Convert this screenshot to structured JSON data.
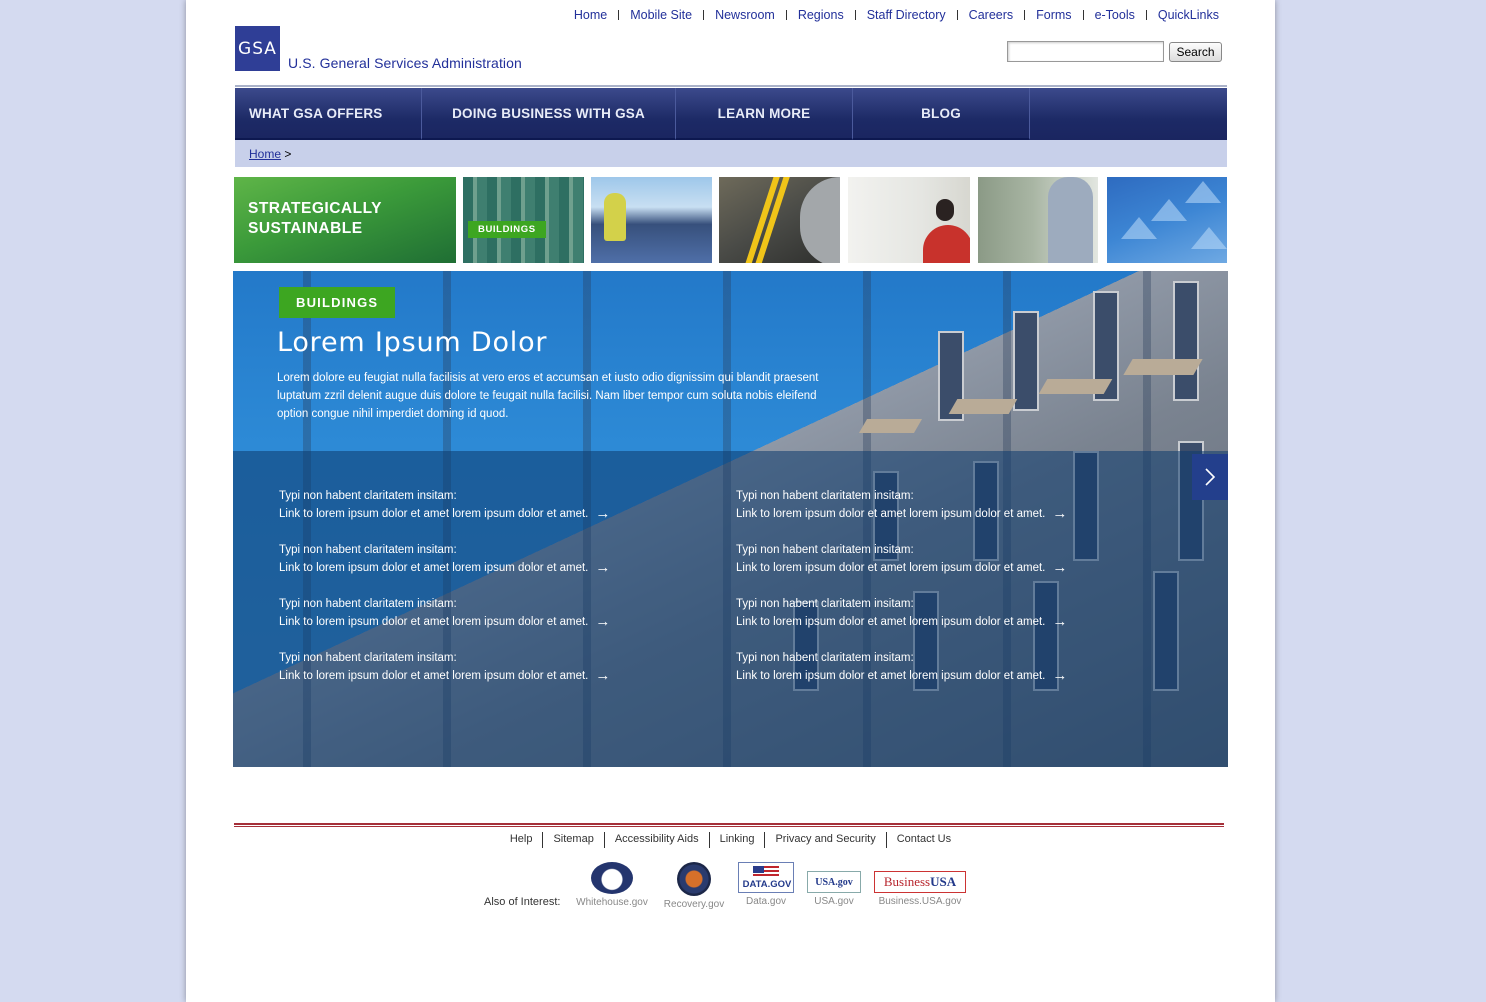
{
  "toplinks": [
    "Home",
    "Mobile Site",
    "Newsroom",
    "Regions",
    "Staff Directory",
    "Careers",
    "Forms",
    "e-Tools",
    "QuickLinks"
  ],
  "logo": {
    "mark": "GSA",
    "name": "U.S. General Services Administration"
  },
  "search": {
    "button": "Search",
    "value": ""
  },
  "nav": [
    "WHAT GSA OFFERS",
    "DOING BUSINESS WITH GSA",
    "LEARN MORE",
    "BLOG"
  ],
  "breadcrumb": {
    "home": "Home",
    "sep": ">"
  },
  "thumbs": {
    "featured": "STRATEGICALLY SUSTAINABLE",
    "badge": "BUILDINGS"
  },
  "hero": {
    "category": "BUILDINGS",
    "title": "Lorem Ipsum Dolor",
    "lead": "Lorem dolore eu feugiat nulla facilisis at vero eros et accumsan et iusto odio dignissim qui blandit praesent luptatum zzril delenit augue duis dolore te feugait nulla facilisi. Nam liber tempor cum soluta nobis eleifend option congue nihil imperdiet doming id quod.",
    "next_icon": "chevron-right-icon",
    "link_heading": "Typi non habent claritatem insitam:",
    "link_text": "Link to lorem ipsum dolor et amet lorem ipsum dolor et amet."
  },
  "footer": {
    "links": [
      "Help",
      "Sitemap",
      "Accessibility Aids",
      "Linking",
      "Privacy and Security",
      "Contact Us"
    ],
    "also": "Also of Interest:",
    "sites": [
      "Whitehouse.gov",
      "Recovery.gov",
      "Data.gov",
      "USA.gov",
      "Business.USA.gov"
    ],
    "datagov_logo": "DATA.GOV",
    "usagov_logo": "USA.gov",
    "business_logo": [
      "Business",
      "USA"
    ]
  }
}
